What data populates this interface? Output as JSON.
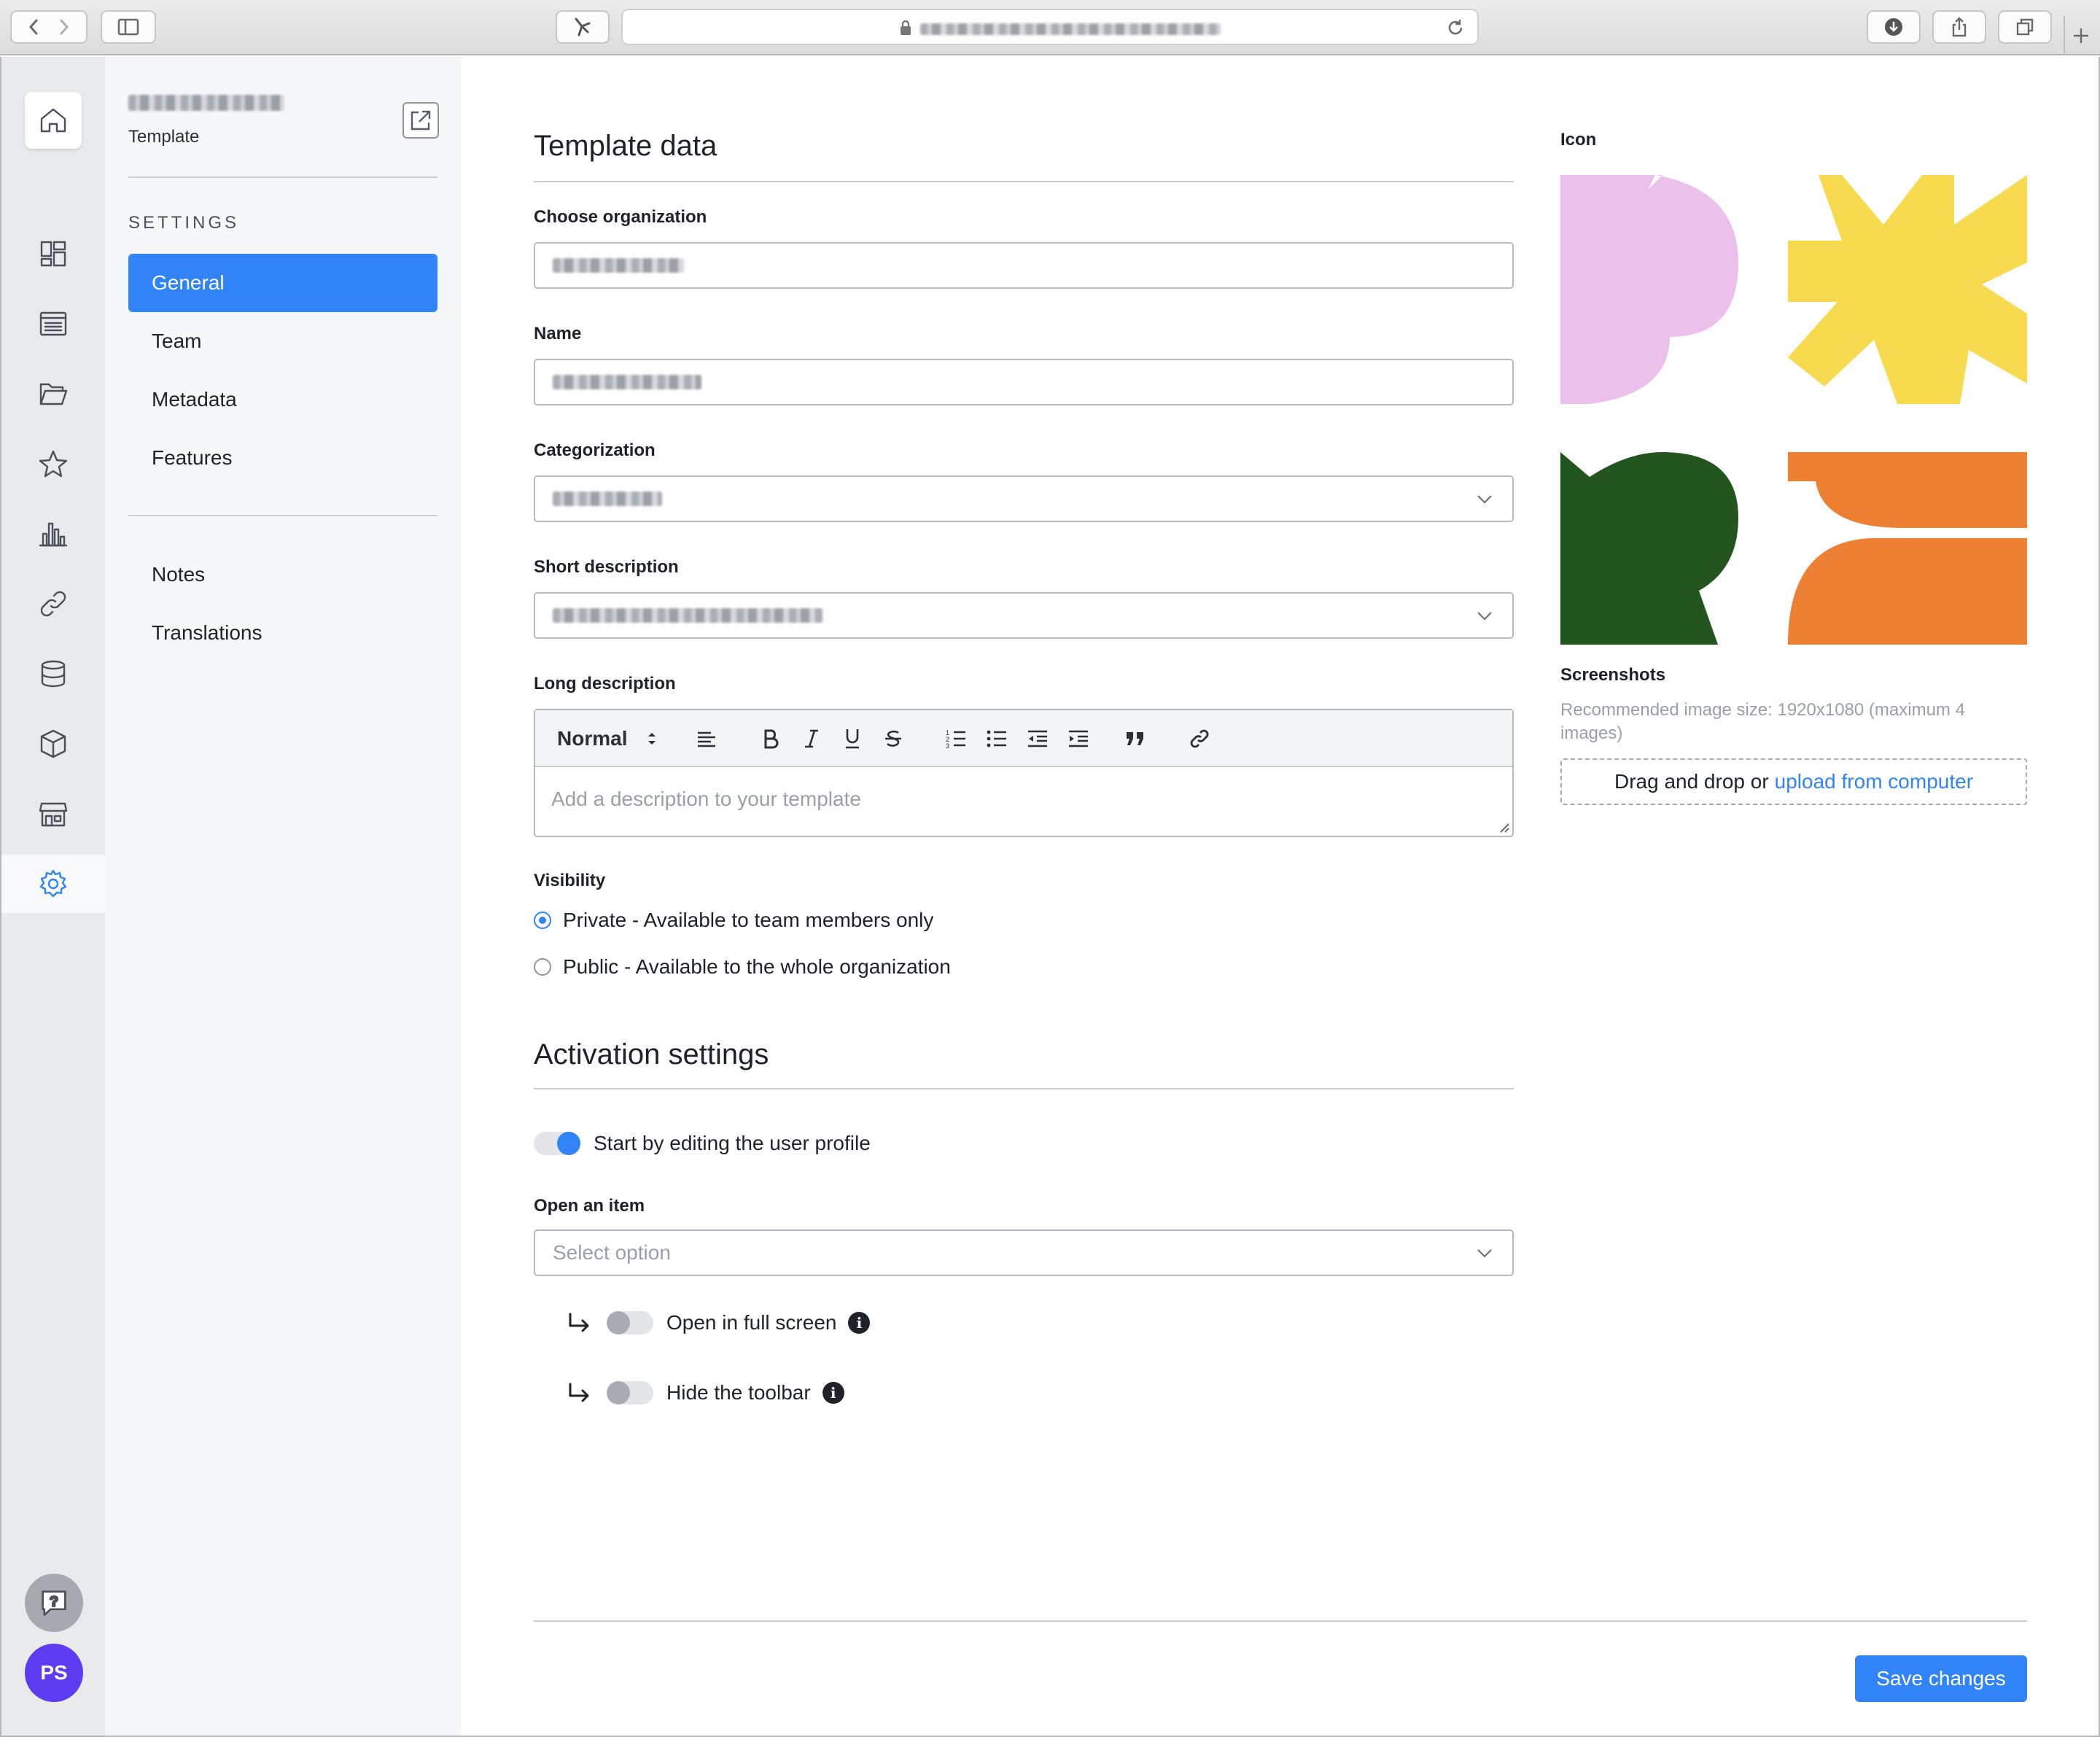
{
  "browser": {
    "icons": [
      "back-icon",
      "forward-icon",
      "sidebar-icon",
      "extension-icon",
      "lock-icon",
      "reload-icon",
      "download-icon",
      "share-icon",
      "tabs-icon",
      "new-tab-icon"
    ]
  },
  "rail": {
    "items": [
      "home-icon",
      "dashboard-icon",
      "list-icon",
      "folder-icon",
      "star-icon",
      "chart-icon",
      "link-icon",
      "database-icon",
      "package-icon",
      "store-icon",
      "settings-icon"
    ],
    "active": "settings-icon",
    "avatar_initials": "PS"
  },
  "sidebar": {
    "subtitle": "Template",
    "section_label": "SETTINGS",
    "items": [
      {
        "label": "General",
        "active": true
      },
      {
        "label": "Team",
        "active": false
      },
      {
        "label": "Metadata",
        "active": false
      },
      {
        "label": "Features",
        "active": false
      }
    ],
    "items2": [
      {
        "label": "Notes"
      },
      {
        "label": "Translations"
      }
    ]
  },
  "template_data": {
    "heading": "Template data",
    "org_label": "Choose organization",
    "name_label": "Name",
    "categorization_label": "Categorization",
    "short_desc_label": "Short description",
    "long_desc_label": "Long description",
    "editor": {
      "style_select": "Normal",
      "placeholder": "Add a description to your template",
      "tools": [
        "align-icon",
        "bold-icon",
        "italic-icon",
        "underline-icon",
        "strikethrough-icon",
        "ordered-list-icon",
        "bullet-list-icon",
        "outdent-icon",
        "indent-icon",
        "quote-icon",
        "link-icon"
      ]
    },
    "visibility_label": "Visibility",
    "visibility_options": [
      {
        "label": "Private - Available to team members only",
        "selected": true
      },
      {
        "label": "Public - Available to the whole organization",
        "selected": false
      }
    ]
  },
  "activation": {
    "heading": "Activation settings",
    "start_toggle_label": "Start by editing the user profile",
    "start_toggle_on": true,
    "open_item_label": "Open an item",
    "open_item_placeholder": "Select option",
    "sub_options": [
      {
        "label": "Open in full screen",
        "on": false
      },
      {
        "label": "Hide the toolbar",
        "on": false
      }
    ]
  },
  "right": {
    "icon_label": "Icon",
    "screenshots_label": "Screenshots",
    "screenshots_hint": "Recommended image size: 1920x1080 (maximum 4 images)",
    "dropzone_text": "Drag and drop or",
    "dropzone_link": "upload from computer",
    "icon_colors": {
      "pink": "#ebc0eb",
      "yellow": "#f8da4e",
      "green": "#22561e",
      "orange": "#ee8033"
    }
  },
  "footer": {
    "save_label": "Save changes"
  },
  "colors": {
    "accent": "#3184f7",
    "avatar_bg": "#5b3cf0"
  }
}
